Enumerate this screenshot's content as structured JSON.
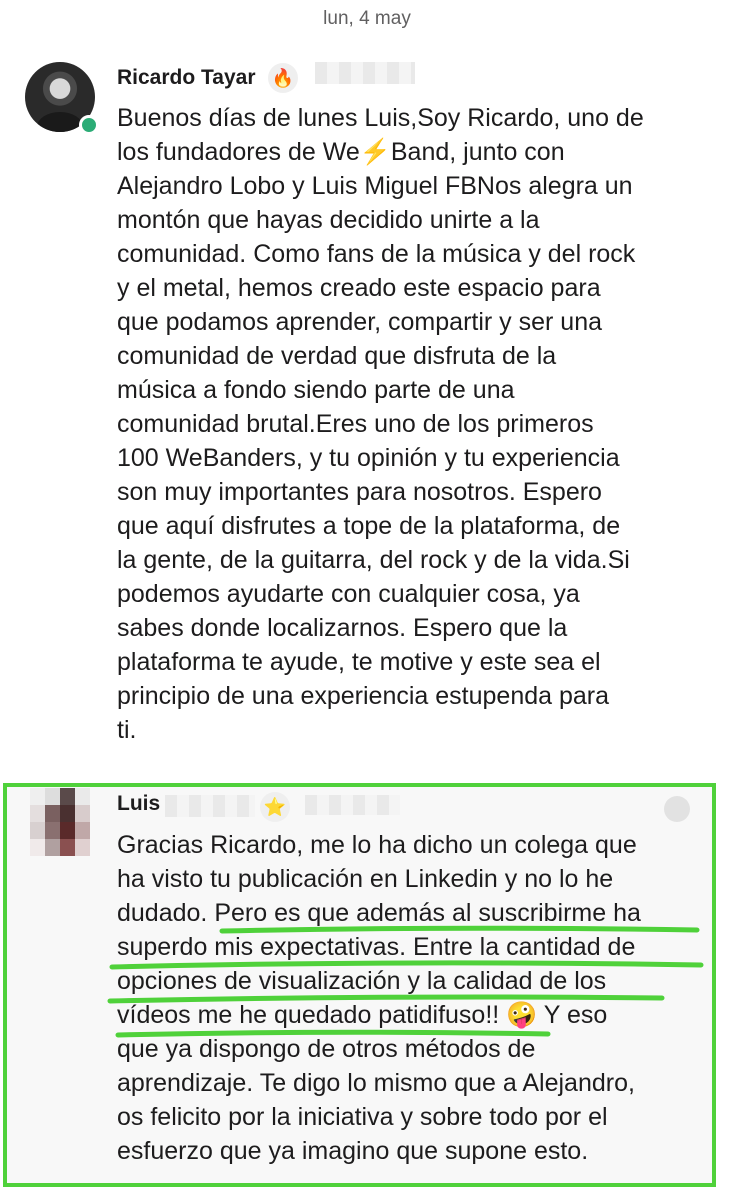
{
  "date_divider": "lun, 4 may",
  "messages": [
    {
      "sender": "Ricardo Tayar",
      "status_emoji": "🔥",
      "lines": [
        "Buenos días de lunes Luis,Soy Ricardo, uno de",
        "los fundadores de We⚡Band, junto con",
        "Alejandro Lobo y Luis Miguel FBNos alegra un",
        "montón que hayas decidido unirte a la",
        "comunidad. Como fans de la música y del rock",
        "y el metal, hemos creado este espacio para",
        "que podamos aprender, compartir y ser una",
        "comunidad de verdad que disfruta de la",
        "música a fondo siendo parte de una",
        "comunidad brutal.Eres uno de los primeros",
        "100 WeBanders, y tu opinión y tu experiencia",
        "son muy importantes para nosotros. Espero",
        "que aquí disfrutes a tope de la plataforma, de",
        "la gente, de la guitarra, del rock y de la vida.Si",
        "podemos ayudarte con cualquier cosa, ya",
        "sabes donde localizarnos. Espero que la",
        "plataforma te ayude, te motive y este sea el",
        "principio de una experiencia estupenda para",
        "ti."
      ]
    },
    {
      "sender": "Luis",
      "status_emoji": "⭐",
      "lines": [
        "Gracias Ricardo, me lo ha dicho un colega que",
        "ha visto tu publicación en Linkedin y no lo he",
        "dudado. Pero es que además al suscribirme ha",
        "superdo mis expectativas. Entre la cantidad de",
        "opciones de visualización y la calidad de los",
        "vídeos me he quedado patidifuso!! 🤪 Y eso",
        "que ya dispongo de otros métodos de",
        "aprendizaje. Te digo lo mismo que a Alejandro,",
        "os felicito por la iniciativa y sobre todo por el",
        "esfuerzo que ya imagino que supone esto."
      ]
    }
  ],
  "colors": {
    "highlight_border": "#4fd13a",
    "online_status": "#2bac76"
  },
  "icons": [
    "fire-emoji-icon",
    "star-emoji-icon",
    "presence-indicator-icon"
  ]
}
